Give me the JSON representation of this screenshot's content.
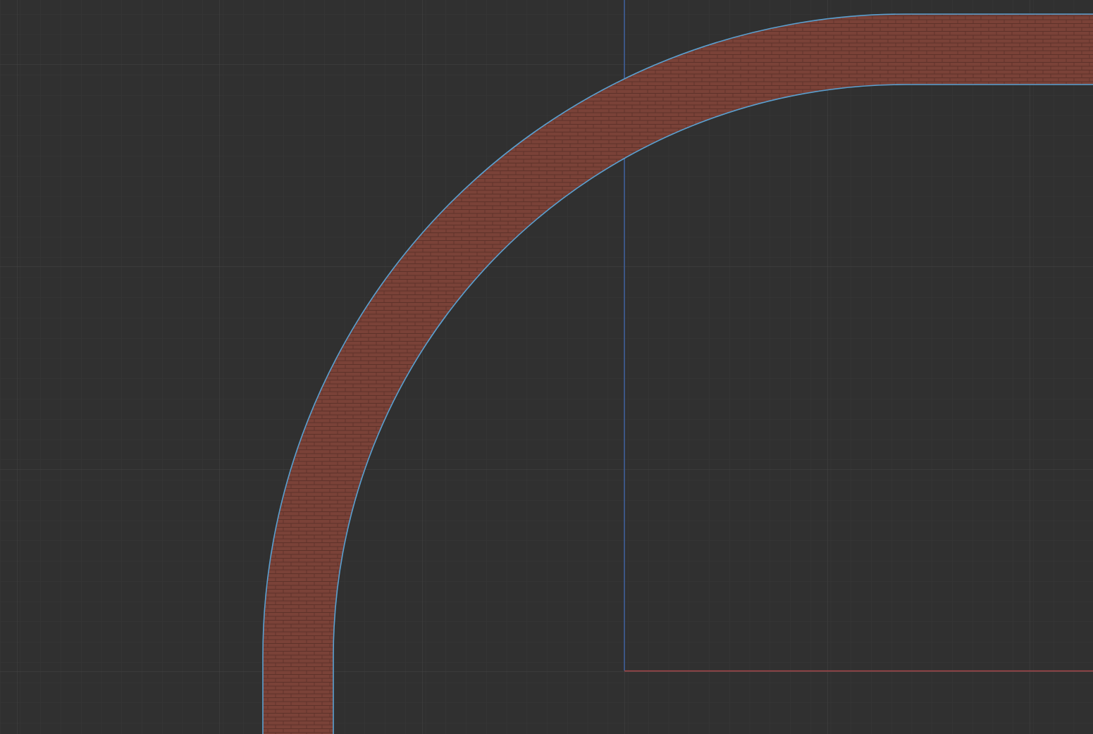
{
  "editor": {
    "mode": "top-orthographic-view",
    "background_color": "#303030",
    "grid": {
      "visible": true,
      "minor_color": "#383838",
      "major_color": "#454545"
    },
    "axes": {
      "y_axis_color": "#3d5f9e",
      "x_axis_color": "#a6454a"
    }
  },
  "scene": {
    "objects": [
      {
        "name": "curved-brick-wall",
        "selected": true,
        "material": {
          "pattern": "brick",
          "base_color": "#7a4238",
          "mortar_color": "#5e322a"
        },
        "selection_outline_color": "#5aa0d0"
      }
    ]
  }
}
